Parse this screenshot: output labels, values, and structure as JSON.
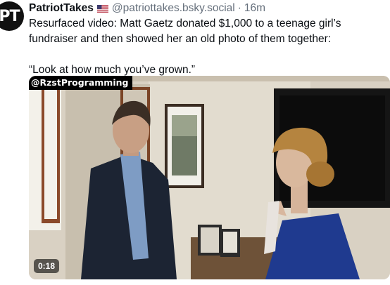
{
  "post": {
    "avatar_text": "PT",
    "display_name": "PatriotTakes",
    "flag": "us-flag-icon",
    "handle": "@patriottakes.bsky.social",
    "separator": "·",
    "timestamp": "16m",
    "text_lines": [
      "Resurfaced video: Matt Gaetz donated $1,000 to a teenage girl’s",
      "fundraiser and then showed her an old photo of them together:",
      "",
      "“Look at how much you’ve grown.”"
    ]
  },
  "video": {
    "watermark": "@RzstProgramming",
    "duration": "0:18"
  },
  "colors": {
    "text": "#0b0f14",
    "muted": "#66707c",
    "avatar_bg": "#111111"
  }
}
